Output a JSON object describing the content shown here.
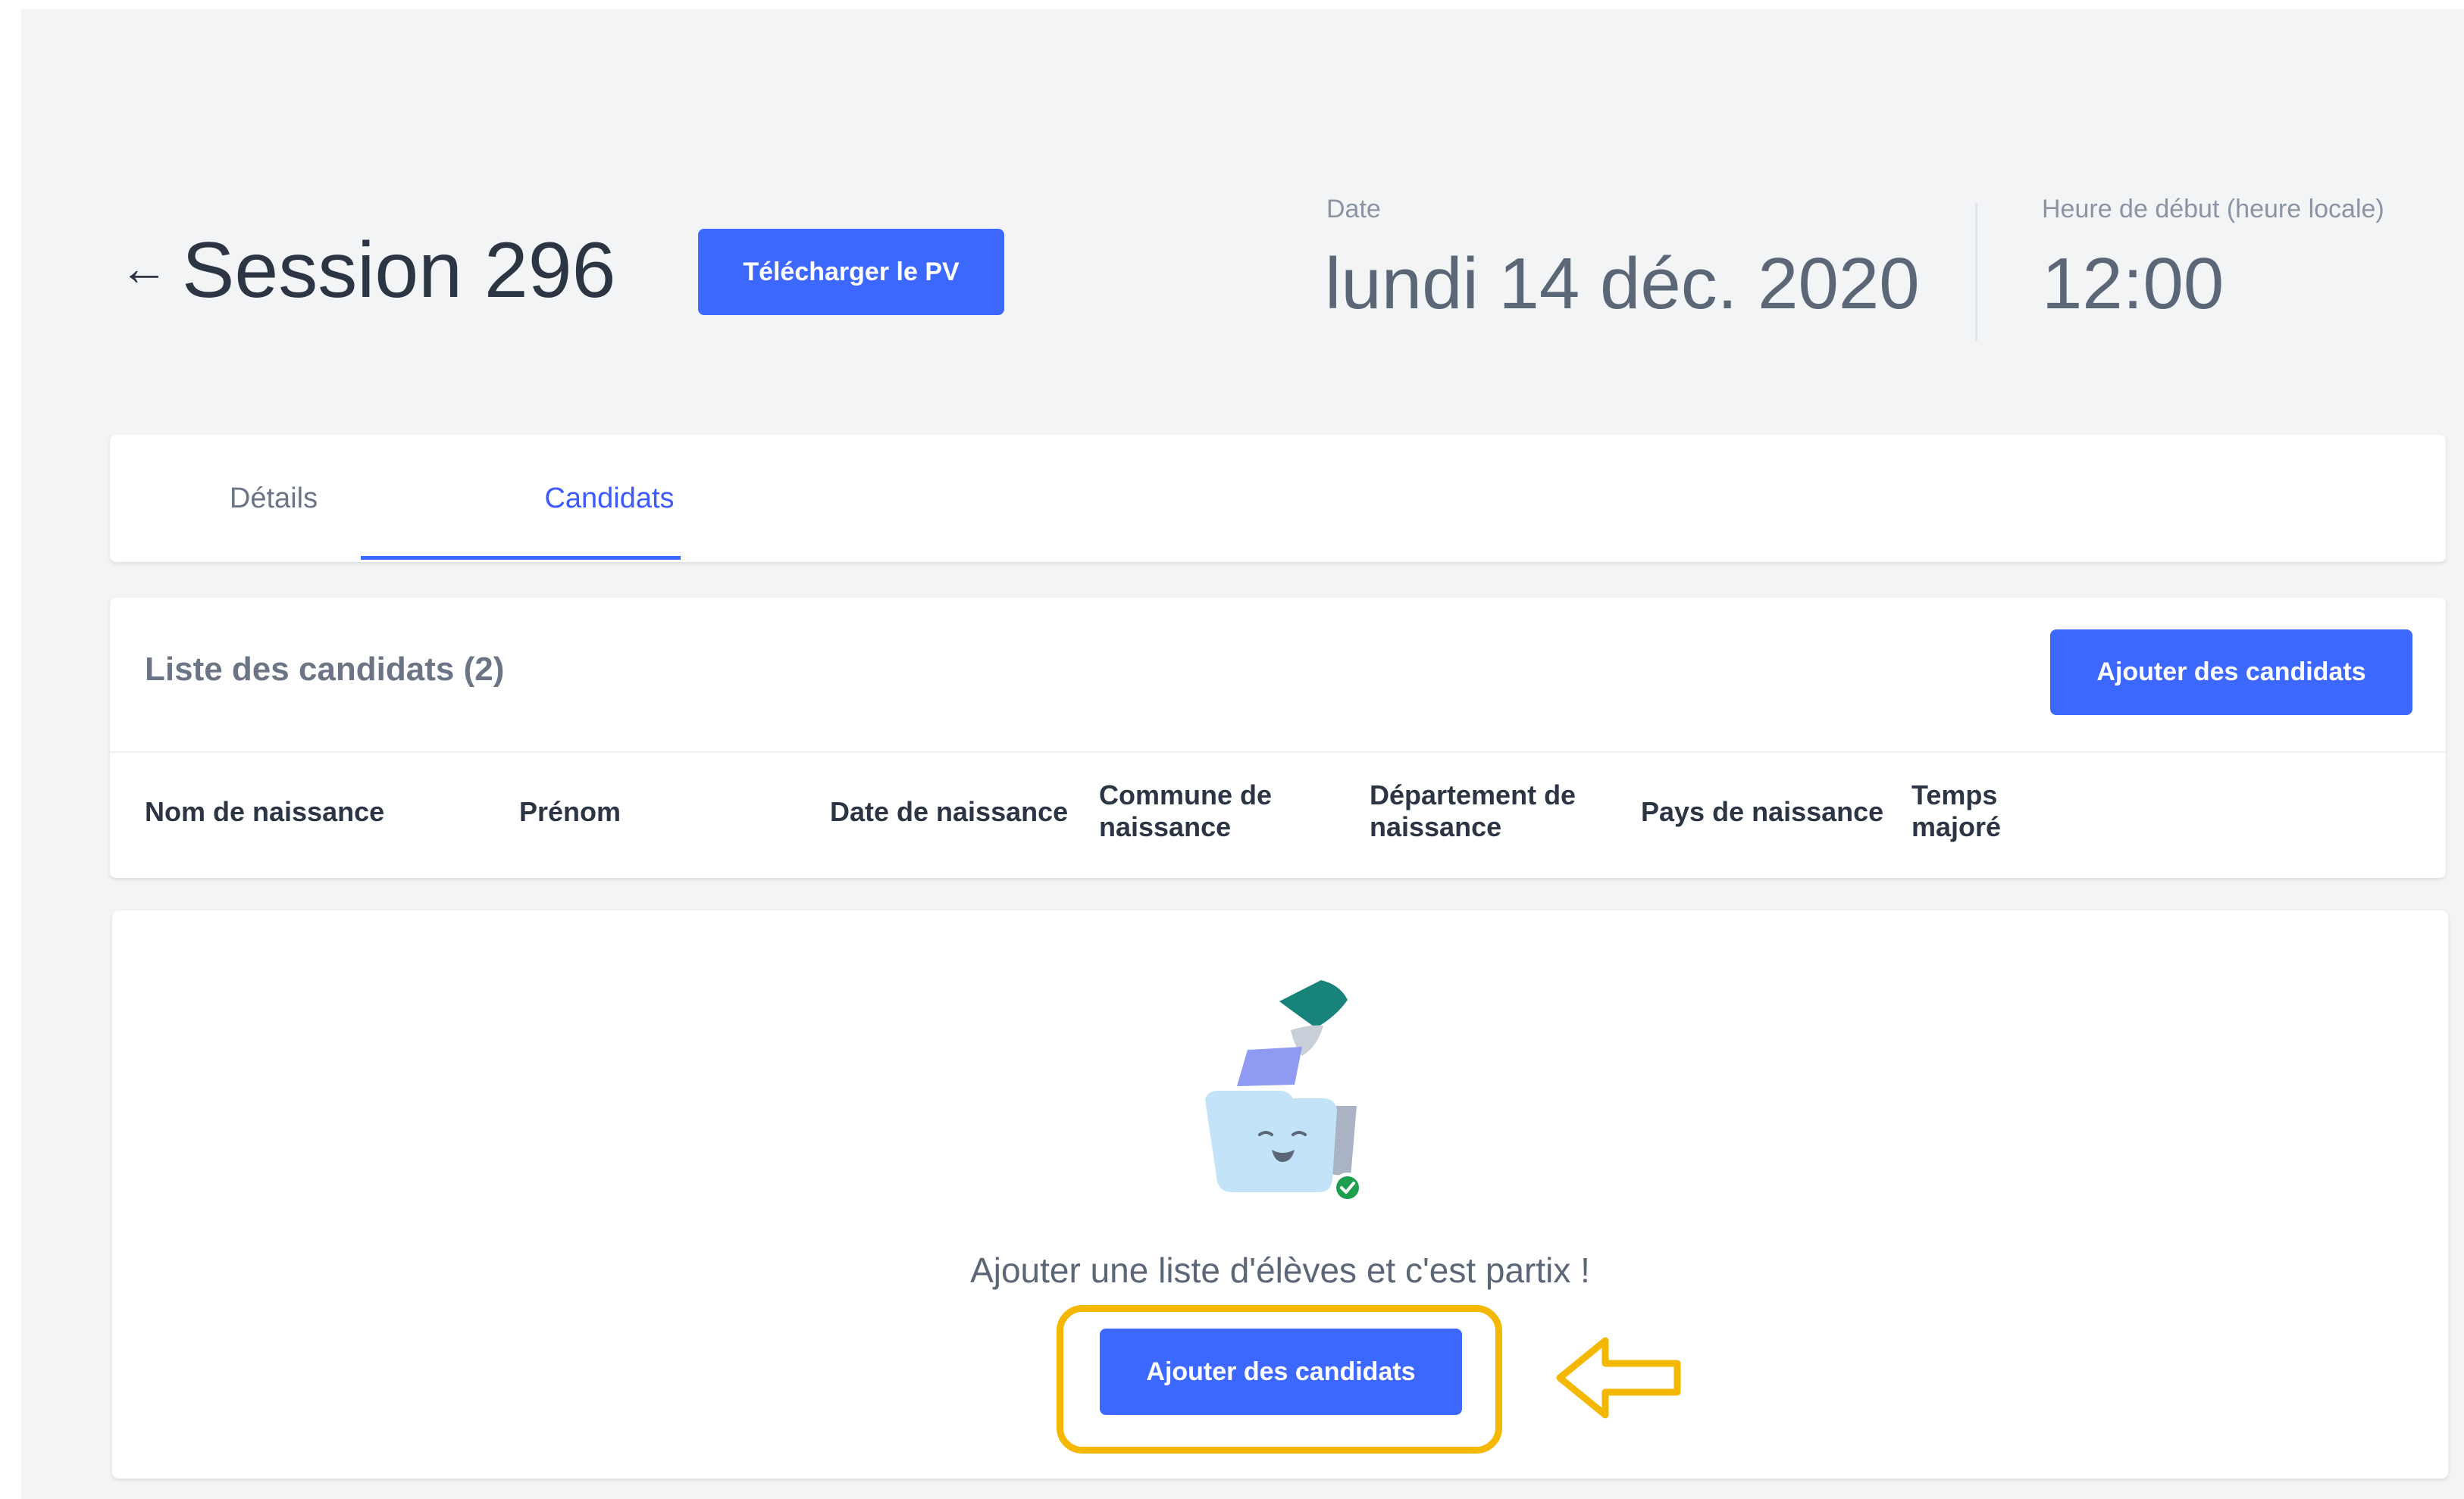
{
  "header": {
    "title": "Session 296",
    "download_label": "Télécharger le PV",
    "date_label": "Date",
    "date_value": "lundi 14 déc. 2020",
    "time_label": "Heure de début (heure locale)",
    "time_value": "12:00"
  },
  "tabs": [
    {
      "label": "Détails",
      "active": false
    },
    {
      "label": "Candidats",
      "active": true
    }
  ],
  "candidates": {
    "title": "Liste des candidats (2)",
    "add_label": "Ajouter des candidats",
    "columns": [
      "Nom de naissance",
      "Prénom",
      "Date de naissance",
      "Commune de naissance",
      "Département de naissance",
      "Pays de naissance",
      "Temps majoré"
    ]
  },
  "empty_state": {
    "message": "Ajouter une liste d'élèves et c'est partix !",
    "add_label": "Ajouter des candidats"
  },
  "colors": {
    "accent": "#3d68ff",
    "highlight": "#f5b800",
    "background": "#f3f4f5"
  },
  "icons": [
    "back-arrow-icon",
    "empty-folder-illustration",
    "callout-arrow-icon"
  ]
}
